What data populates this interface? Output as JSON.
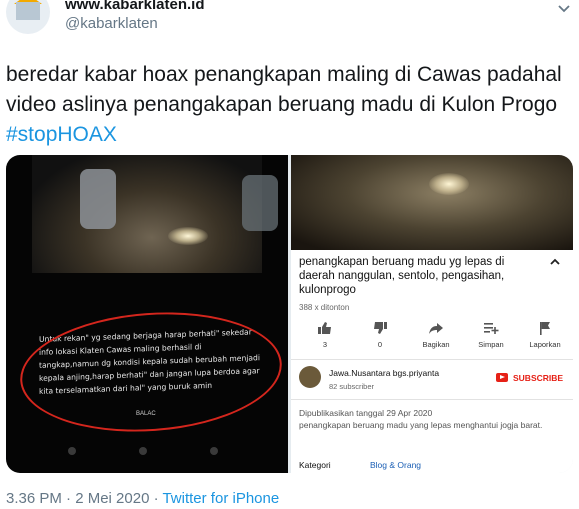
{
  "header": {
    "display_name": "www.kabarklaten.id",
    "handle": "@kabarklaten",
    "avatar_icon": "kabarklaten-logo-icon",
    "menu_icon": "chevron-down-icon"
  },
  "tweet": {
    "text_main": "beredar kabar hoax penangkapan maling di Cawas padahal video aslinya penangakapan beruang madu di Kulon Progo ",
    "hashtag": "#stopHOAX"
  },
  "left_screenshot": {
    "caption": "Untuk rekan\" yg sedang berjaga harap berhati\" sekedar info lokasi Klaten Cawas maling berhasil di tangkap,namun dg kondisi kepala sudah berubah menjadi kepala anjing,harap berhati\" dan jangan lupa berdoa agar kita terselamatkan dari hal\" yang buruk amin",
    "watermark": "BALAC"
  },
  "right_screenshot": {
    "video_title": "penangkapan beruang madu yg lepas di daerah nanggulan, sentolo, pengasihan, kulonprogo",
    "views": "388 x ditonton",
    "actions": [
      {
        "icon": "thumbs-up-icon",
        "label": "3"
      },
      {
        "icon": "thumbs-down-icon",
        "label": "0"
      },
      {
        "icon": "share-icon",
        "label": "Bagikan"
      },
      {
        "icon": "add-to-playlist-icon",
        "label": "Simpan"
      },
      {
        "icon": "flag-icon",
        "label": "Laporkan"
      }
    ],
    "channel_name": "Jawa.Nusantara bgs.priyanta",
    "subscribers": "82 subscriber",
    "subscribe_label": "SUBSCRIBE",
    "published": "Dipublikasikan tanggal 29 Apr 2020",
    "description": "penangkapan beruang madu yang lepas menghantui jogja barat.",
    "category_label": "Kategori",
    "category_value": "Blog & Orang"
  },
  "footer": {
    "time_date": "3.36 PM · 2 Mei 2020 · ",
    "source": "Twitter for iPhone"
  },
  "colors": {
    "link": "#1b95e0",
    "annotation_circle": "#d4261d",
    "youtube_red": "#e62117"
  }
}
